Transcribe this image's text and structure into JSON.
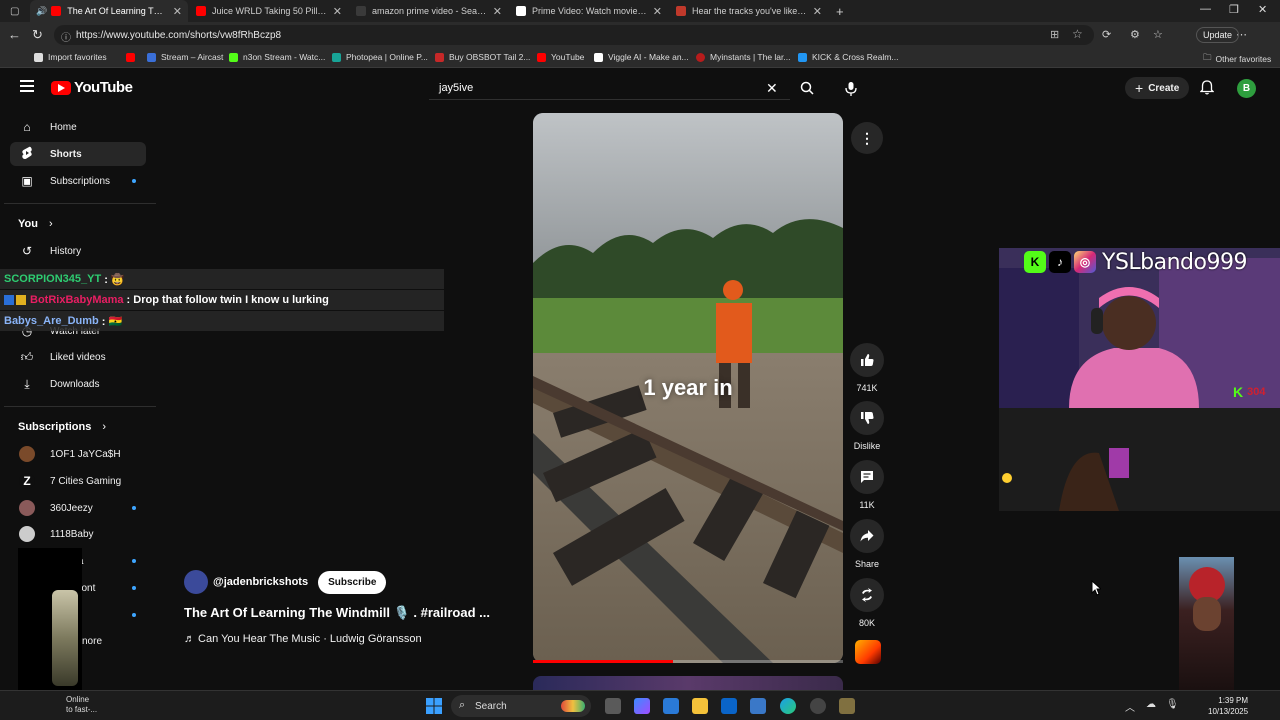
{
  "browser": {
    "tabs": [
      {
        "title": "The Art Of Learning The Wind",
        "color": "#ff0000",
        "active": true
      },
      {
        "title": "Juice WRLD Taking 50 Pills Becau",
        "color": "#ff0000"
      },
      {
        "title": "amazon prime video - Search",
        "color": "#3a3a3a"
      },
      {
        "title": "Prime Video: Watch movies, TV sh",
        "color": "#ffffff"
      },
      {
        "title": "Hear the tracks you've liked: on S",
        "color": "#c0392b"
      }
    ],
    "new_tab": "+",
    "url": "https://www.youtube.com/shorts/vw8fRhBczp8",
    "update_label": "Update",
    "bookmarks": [
      {
        "label": "Import favorites",
        "color": "#dddddd"
      },
      {
        "label": "Stream – Aircast",
        "color": "#3a6fd8"
      },
      {
        "label": "n3on Stream - Watc...",
        "color": "#53fc18"
      },
      {
        "label": "Photopea | Online P...",
        "color": "#18a497"
      },
      {
        "label": "Buy OBSBOT Tail 2...",
        "color": "#c62828"
      },
      {
        "label": "YouTube",
        "color": "#ff0000"
      },
      {
        "label": "Viggle AI - Make an...",
        "color": "#ffffff"
      },
      {
        "label": "Myinstants | The lar...",
        "color": "#b71c1c"
      },
      {
        "label": "KICK & Cross Realm...",
        "color": "#2196f3"
      }
    ],
    "other_favorites": "Other favorites"
  },
  "yt": {
    "logo_text": "YouTube",
    "search_value": "jay5ive",
    "create_label": "Create",
    "avatar_letter": "B",
    "sidebar": {
      "main": [
        {
          "label": "Home",
          "icon": "home-icon"
        },
        {
          "label": "Shorts",
          "icon": "shorts-icon",
          "active": true
        },
        {
          "label": "Subscriptions",
          "icon": "subscriptions-icon",
          "dot": true
        }
      ],
      "you_header": "You",
      "you_items": [
        {
          "label": "History",
          "icon": "history-icon"
        },
        {
          "label": "Watch later",
          "icon": "watch-later-icon"
        },
        {
          "label": "Liked videos",
          "icon": "like-icon"
        },
        {
          "label": "Downloads",
          "icon": "download-icon"
        }
      ],
      "subs_header": "Subscriptions",
      "subs": [
        {
          "label": "1OF1 JaYCa$H",
          "color": "#7a4a2a"
        },
        {
          "label": "7 Cities Gaming",
          "color": "#ffffff"
        },
        {
          "label": "360Jeezy",
          "color": "#8a5a5a",
          "dot": true
        },
        {
          "label": "1118Baby",
          "color": "#cccccc"
        },
        {
          "label": "cruzza",
          "color": "#555555",
          "dot": true
        },
        {
          "label": "damont",
          "color": "#444444",
          "dot": true
        },
        {
          "label": "",
          "color": "#333333",
          "dot": true
        },
        {
          "label": "nore",
          "color": "#333333"
        }
      ]
    },
    "short": {
      "caption": "1 year in",
      "channel": "@jadenbrickshots",
      "subscribe": "Subscribe",
      "title": "The Art Of Learning The Windmill 🎙️ . #railroad ...",
      "music": "♬ Can You Hear The Music · Ludwig Göransson",
      "progress": 0.45
    },
    "actions": {
      "likes": "741K",
      "dislike": "Dislike",
      "comments": "11K",
      "share": "Share",
      "remix": "80K"
    }
  },
  "chat": [
    {
      "user": "SCORPION345_YT",
      "user_color": "#2ecc71",
      "msg": ": 🤠"
    },
    {
      "user": "BotRixBabyMama",
      "user_color": "#e91e63",
      "msg": ": Drop that follow twin I know u lurking"
    },
    {
      "user": "Babys_Are_Dumb",
      "user_color": "#8ab4f8",
      "msg": ": 🇬🇭"
    }
  ],
  "stream": {
    "handle": "YSLbando999",
    "kick_count": "304"
  },
  "taskbar": {
    "weather_line1": "Online",
    "weather_line2": "to fast-...",
    "search": "Search",
    "time": "1:39 PM",
    "date": "10/13/2025"
  }
}
